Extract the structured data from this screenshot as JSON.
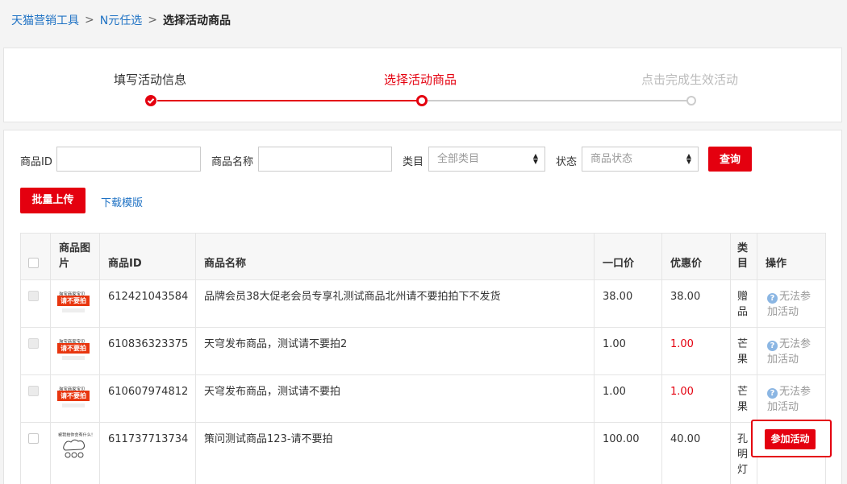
{
  "breadcrumb": {
    "item1": "天猫营销工具",
    "item2": "N元任选",
    "current": "选择活动商品",
    "separator": ">"
  },
  "steps": {
    "step1": "填写活动信息",
    "step2": "选择活动商品",
    "step3": "点击完成生效活动"
  },
  "filter": {
    "id_label": "商品ID",
    "name_label": "商品名称",
    "category_label": "类目",
    "category_value": "全部类目",
    "status_label": "状态",
    "status_value": "商品状态",
    "query_button": "查询",
    "batch_upload": "批量上传",
    "download_template": "下载模版"
  },
  "table": {
    "headers": {
      "image": "商品图片",
      "id": "商品ID",
      "name": "商品名称",
      "price": "一口价",
      "promo": "优惠价",
      "category": "类目",
      "action": "操作"
    },
    "thumb_text_top": "淘宝商家宝贝",
    "thumb_text_mid": "请不要拍",
    "thumb2_text": "被我拍你会有什么！",
    "rows": [
      {
        "id": "612421043584",
        "name": "品牌会员38大促老会员专享礼测试商品北州请不要拍拍下不发货",
        "price": "38.00",
        "promo": "38.00",
        "category": "赠品",
        "action": "无法参加活动"
      },
      {
        "id": "610836323375",
        "name": "天穹发布商品，测试请不要拍2",
        "price": "1.00",
        "promo": "1.00",
        "category": "芒果",
        "action": "无法参加活动"
      },
      {
        "id": "610607974812",
        "name": "天穹发布商品，测试请不要拍",
        "price": "1.00",
        "promo": "1.00",
        "category": "芒果",
        "action": "无法参加活动"
      },
      {
        "id": "611737713734",
        "name": "策问测试商品123-请不要拍",
        "price": "100.00",
        "promo": "40.00",
        "category": "孔明灯",
        "action": "参加活动"
      }
    ]
  },
  "colors": {
    "accent": "#e4000f",
    "link": "#1f72c4",
    "disabled_step": "#cccccc"
  }
}
